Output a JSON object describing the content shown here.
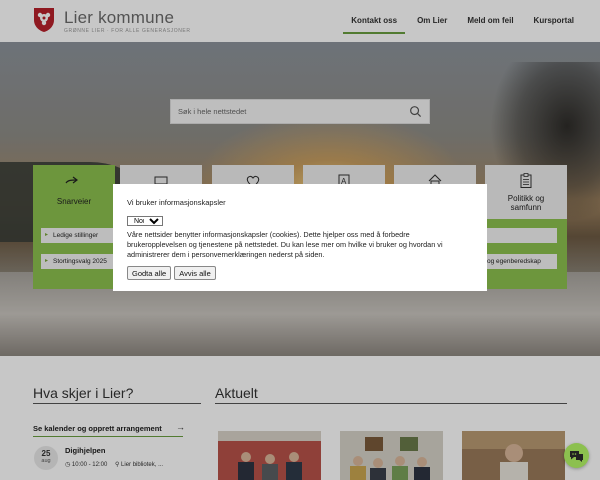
{
  "header": {
    "brand_name": "Lier kommune",
    "brand_tagline": "GRØNNE LIER · FOR ALLE GENERASJONER",
    "nav": [
      {
        "label": "Kontakt oss",
        "active": true
      },
      {
        "label": "Om Lier",
        "active": false
      },
      {
        "label": "Meld om feil",
        "active": false
      },
      {
        "label": "Kursportal",
        "active": false
      }
    ]
  },
  "search": {
    "placeholder": "Søk i hele nettstedet",
    "icon": "search-icon"
  },
  "tiles": [
    {
      "label": "Snarveier",
      "icon": "arrow-right-icon"
    },
    {
      "label": "",
      "icon": "vehicle-icon"
    },
    {
      "label": "",
      "icon": "heart-icon"
    },
    {
      "label": "",
      "icon": "education-icon"
    },
    {
      "label": "",
      "icon": "house-icon"
    },
    {
      "label": "Politikk og samfunn",
      "icon": "clipboard-icon"
    }
  ],
  "shortcuts": [
    {
      "label": "Ledige stillinger"
    },
    {
      "label": "Stortingsvalg 2025"
    },
    {
      "label": "og egenberedskap"
    }
  ],
  "cookie": {
    "title": "Vi bruker informasjonskapsler",
    "language": "Norsk",
    "text": "Våre nettsider benytter informasjonskapsler (cookies). Dette hjelper oss med å forbedre brukeropplevelsen og tjenestene på nettstedet. Du kan lese mer om hvilke vi bruker og hvordan vi administrerer dem i personvernerklæringen nederst på siden.",
    "accept_label": "Godta alle",
    "reject_label": "Avvis alle"
  },
  "events": {
    "title": "Hva skjer i Lier?",
    "calendar_link": "Se kalender og opprett arrangement",
    "items": [
      {
        "day": "25",
        "month": "aug",
        "title": "Digihjelpen",
        "time": "10:00 - 12:00",
        "place": "Lier bibliotek, ..."
      }
    ]
  },
  "news": {
    "title": "Aktuelt"
  },
  "colors": {
    "accent": "#8cc04f",
    "accent_dark": "#6a9e3f"
  }
}
